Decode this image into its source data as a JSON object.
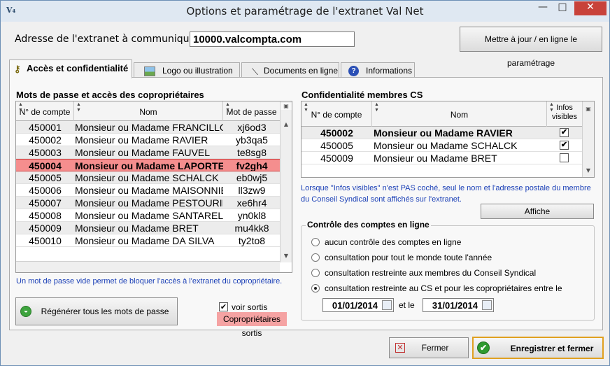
{
  "window": {
    "title": "Options et paramétrage de l'extranet Val Net",
    "controls": {
      "minimize": "—",
      "maximize": "□",
      "close": "✕"
    }
  },
  "address": {
    "label": "Adresse de l'extranet à communiquer :",
    "value": "10000.valcompta.com",
    "update_button": "Mettre à jour / en ligne le paramétrage"
  },
  "tabs": [
    {
      "label": "Accès et confidentialité",
      "icon": "key-icon",
      "active": true
    },
    {
      "label": "Logo ou illustration",
      "icon": "picture-icon",
      "active": false
    },
    {
      "label": "Documents en ligne",
      "icon": "document-icon",
      "active": false
    },
    {
      "label": "Informations",
      "icon": "help-icon",
      "active": false
    }
  ],
  "owners": {
    "title": "Mots de passe et accès des copropriétaires",
    "columns": [
      "N° de compte",
      "Nom",
      "Mot de passe"
    ],
    "rows": [
      {
        "account": "450001",
        "name": "Monsieur ou Madame FRANCILLON",
        "password": "xj6od3"
      },
      {
        "account": "450002",
        "name": "Monsieur ou Madame RAVIER",
        "password": "yb3qa5"
      },
      {
        "account": "450003",
        "name": "Monsieur ou Madame FAUVEL",
        "password": "te8sg8"
      },
      {
        "account": "450004",
        "name": "Monsieur ou Madame LAPORTE",
        "password": "fv2gh4",
        "selected": true
      },
      {
        "account": "450005",
        "name": "Monsieur ou Madame SCHALCK",
        "password": "eb0wj5"
      },
      {
        "account": "450006",
        "name": "Monsieur ou Madame MAISONNIER",
        "password": "ll3zw9"
      },
      {
        "account": "450007",
        "name": "Monsieur ou Madame PESTOURIE",
        "password": "xe6hr4"
      },
      {
        "account": "450008",
        "name": "Monsieur ou Madame SANTARELLI",
        "password": "yn0kl8"
      },
      {
        "account": "450009",
        "name": "Monsieur ou Madame BRET",
        "password": "mu4kk8"
      },
      {
        "account": "450010",
        "name": "Monsieur ou Madame DA SILVA",
        "password": "ty2to8"
      }
    ],
    "note": "Un mot de passe vide permet de bloquer l'accès à l'extranet du copropriétaire.",
    "regenerate_button": "Régénérer tous les mots de passe",
    "show_out_label": "voir sortis",
    "show_out_checked": true,
    "out_owners_label": "Copropriétaires sortis"
  },
  "cs": {
    "title": "Confidentialité membres CS",
    "columns": [
      "N° de compte",
      "Nom",
      "Infos visibles"
    ],
    "rows": [
      {
        "account": "450002",
        "name": "Monsieur ou Madame RAVIER",
        "visible": true,
        "bold": true
      },
      {
        "account": "450005",
        "name": "Monsieur ou Madame SCHALCK",
        "visible": true
      },
      {
        "account": "450009",
        "name": "Monsieur ou Madame BRET",
        "visible": false
      }
    ],
    "note": "Lorsque \"Infos visibles\" n'est PAS coché, seul le nom et l'adresse postale du membre du Conseil Syndical sont affichés sur l'extranet.",
    "show_button": "Affiche"
  },
  "control": {
    "title": "Contrôle des comptes en ligne",
    "options": [
      {
        "label": "aucun contrôle des comptes en ligne",
        "selected": false
      },
      {
        "label": "consultation pour tout le monde toute l'année",
        "selected": false
      },
      {
        "label": "consultation restreinte aux membres du Conseil Syndical",
        "selected": false
      },
      {
        "label": "consultation restreinte au CS et pour les copropriétaires entre le",
        "selected": true
      }
    ],
    "date_from": "01/01/2014",
    "and_label": "et le",
    "date_to": "31/01/2014"
  },
  "footer": {
    "close_button": "Fermer",
    "save_button": "Enregistrer et fermer"
  },
  "colors": {
    "selected_row": "#f58e8e",
    "note_text": "#1a3fb6",
    "accent_save": "#e0a020"
  }
}
